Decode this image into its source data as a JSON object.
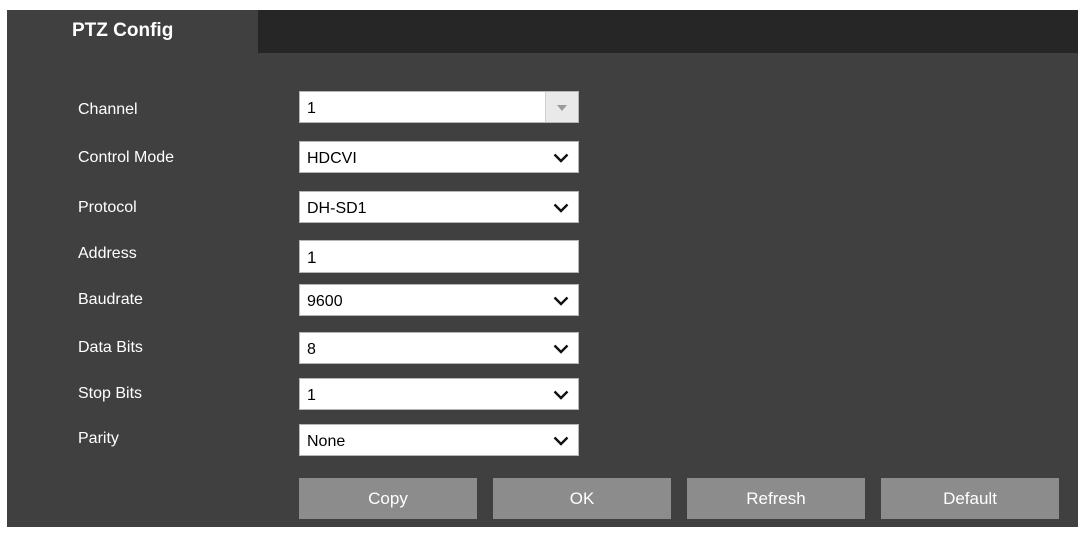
{
  "tab": {
    "title": "PTZ Config"
  },
  "fields": {
    "channel": {
      "label": "Channel",
      "value": "1"
    },
    "control_mode": {
      "label": "Control Mode",
      "value": "HDCVI"
    },
    "protocol": {
      "label": "Protocol",
      "value": "DH-SD1"
    },
    "address": {
      "label": "Address",
      "value": "1"
    },
    "baudrate": {
      "label": "Baudrate",
      "value": "9600"
    },
    "data_bits": {
      "label": "Data Bits",
      "value": "8"
    },
    "stop_bits": {
      "label": "Stop Bits",
      "value": "1"
    },
    "parity": {
      "label": "Parity",
      "value": "None"
    }
  },
  "buttons": {
    "copy": "Copy",
    "ok": "OK",
    "refresh": "Refresh",
    "default": "Default"
  },
  "icons": {
    "dropdown": "chevron-down-icon",
    "disabled_dropdown": "triangle-down-icon"
  },
  "colors": {
    "panel_background": "#404040",
    "tab_strip": "#262626",
    "button": "#8c8c8c",
    "text": "#ffffff"
  }
}
